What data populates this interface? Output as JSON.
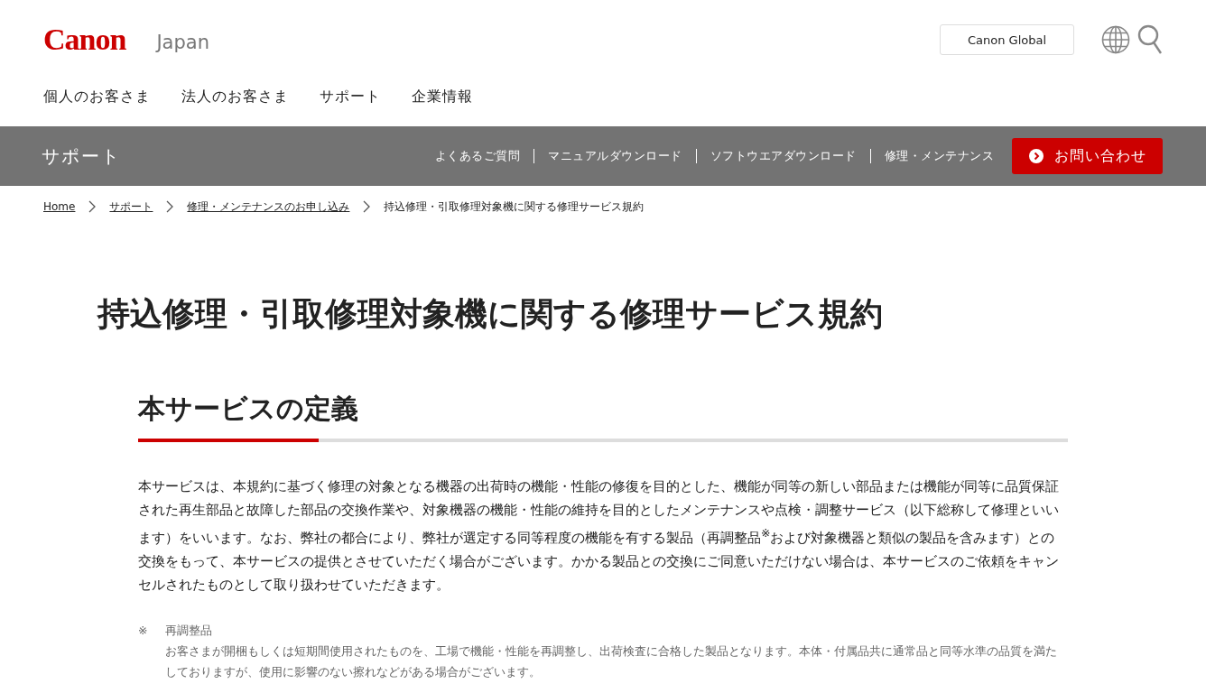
{
  "header": {
    "logo": "Canon",
    "region": "Japan",
    "global_button": "Canon Global",
    "nav": [
      "個人のお客さま",
      "法人のお客さま",
      "サポート",
      "企業情報"
    ]
  },
  "subnav": {
    "title": "サポート",
    "links": [
      "よくあるご質問",
      "マニュアルダウンロード",
      "ソフトウエアダウンロード",
      "修理・メンテナンス"
    ],
    "contact_button": "お問い合わせ"
  },
  "breadcrumb": [
    {
      "label": "Home",
      "link": true
    },
    {
      "label": "サポート",
      "link": true
    },
    {
      "label": "修理・メンテナンスのお申し込み",
      "link": true
    },
    {
      "label": "持込修理・引取修理対象機に関する修理サービス規約",
      "link": false
    }
  ],
  "page_title": "持込修理・引取修理対象機に関する修理サービス規約",
  "section": {
    "heading": "本サービスの定義",
    "paragraph": "本サービスは、本規約に基づく修理の対象となる機器の出荷時の機能・性能の修復を目的とした、機能が同等の新しい部品または機能が同等に品質保証された再生部品と故障した部品の交換作業や、対象機器の機能・性能の維持を目的としたメンテナンスや点検・調整サービス（以下総称して修理といいます）をいいます。なお、弊社の都合により、弊社が選定する同等程度の機能を有する製品（再調整品$^{※}$および対象機器と類似の製品を含みます）との交換をもって、本サービスの提供とさせていただく場合がございます。かかる製品との交換にご同意いただけない場合は、本サービスのご依頼をキャンセルされたものとして取り扱わせていただきます。",
    "note": {
      "mark": "※",
      "term": "再調整品",
      "text": "お客さまが開梱もしくは短期間使用されたものを、工場で機能・性能を再調整し、出荷検査に合格した製品となります。本体・付属品共に通常品と同等水準の品質を満たしておりますが、使用に影響のない擦れなどがある場合がございます。"
    }
  }
}
